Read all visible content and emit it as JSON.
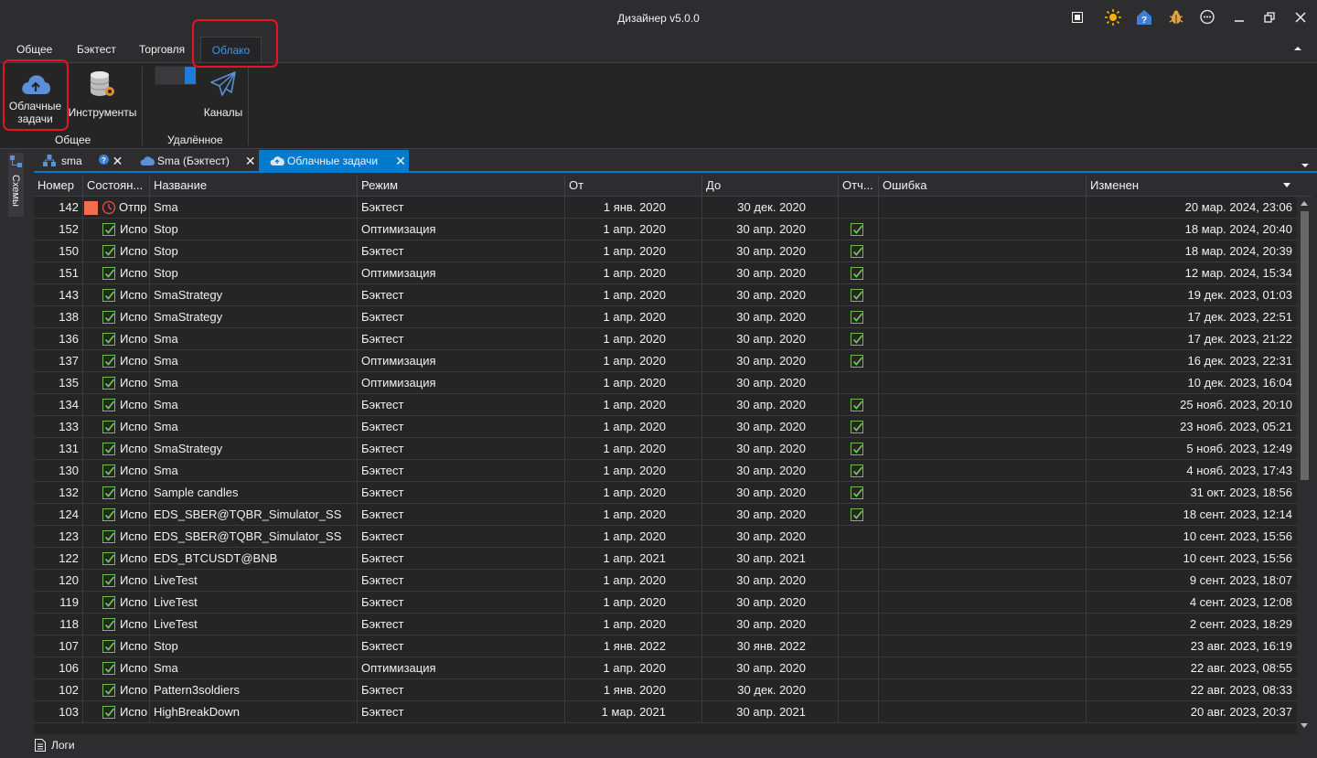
{
  "window": {
    "title": "Дизайнер v5.0.0"
  },
  "ribbon": {
    "tabs": [
      "Общее",
      "Бэктест",
      "Торговля",
      "Облако"
    ],
    "active_tab": "Облако",
    "buttons": {
      "cloud_tasks": "Облачные задачи",
      "cloud_tasks_line1": "Облачные",
      "cloud_tasks_line2": "задачи",
      "instruments": "Инструменты",
      "channels": "Каналы"
    },
    "groups": {
      "general": "Общее",
      "remote": "Удалённое"
    }
  },
  "side": {
    "schemes": "Схемы"
  },
  "doc_tabs": [
    {
      "label": "sma"
    },
    {
      "label": "Sma (Бэктест)"
    },
    {
      "label": "Облачные задачи"
    }
  ],
  "grid": {
    "columns": [
      "Номер",
      "Состоян...",
      "Название",
      "Режим",
      "От",
      "До",
      "Отч...",
      "Ошибка",
      "Изменен"
    ],
    "rows": [
      {
        "num": "142",
        "state": "Отпр",
        "name": "Sma",
        "mode": "Бэктест",
        "from": "1 янв. 2020",
        "to": "30 дек. 2020",
        "report": false,
        "error": "",
        "changed": "20 мар. 2024, 23:06",
        "pending": true
      },
      {
        "num": "152",
        "state": "Испо",
        "name": "Stop",
        "mode": "Оптимизация",
        "from": "1 апр. 2020",
        "to": "30 апр. 2020",
        "report": true,
        "error": "",
        "changed": "18 мар. 2024, 20:40"
      },
      {
        "num": "150",
        "state": "Испо",
        "name": "Stop",
        "mode": "Бэктест",
        "from": "1 апр. 2020",
        "to": "30 апр. 2020",
        "report": true,
        "error": "",
        "changed": "18 мар. 2024, 20:39"
      },
      {
        "num": "151",
        "state": "Испо",
        "name": "Stop",
        "mode": "Оптимизация",
        "from": "1 апр. 2020",
        "to": "30 апр. 2020",
        "report": true,
        "error": "",
        "changed": "12 мар. 2024, 15:34"
      },
      {
        "num": "143",
        "state": "Испо",
        "name": "SmaStrategy",
        "mode": "Бэктест",
        "from": "1 апр. 2020",
        "to": "30 апр. 2020",
        "report": true,
        "error": "",
        "changed": "19 дек. 2023, 01:03"
      },
      {
        "num": "138",
        "state": "Испо",
        "name": "SmaStrategy",
        "mode": "Бэктест",
        "from": "1 апр. 2020",
        "to": "30 апр. 2020",
        "report": true,
        "error": "",
        "changed": "17 дек. 2023, 22:51"
      },
      {
        "num": "136",
        "state": "Испо",
        "name": "Sma",
        "mode": "Бэктест",
        "from": "1 апр. 2020",
        "to": "30 апр. 2020",
        "report": true,
        "error": "",
        "changed": "17 дек. 2023, 21:22"
      },
      {
        "num": "137",
        "state": "Испо",
        "name": "Sma",
        "mode": "Оптимизация",
        "from": "1 апр. 2020",
        "to": "30 апр. 2020",
        "report": true,
        "error": "",
        "changed": "16 дек. 2023, 22:31"
      },
      {
        "num": "135",
        "state": "Испо",
        "name": "Sma",
        "mode": "Оптимизация",
        "from": "1 апр. 2020",
        "to": "30 апр. 2020",
        "report": false,
        "error": "",
        "changed": "10 дек. 2023, 16:04"
      },
      {
        "num": "134",
        "state": "Испо",
        "name": "Sma",
        "mode": "Бэктест",
        "from": "1 апр. 2020",
        "to": "30 апр. 2020",
        "report": true,
        "error": "",
        "changed": "25 нояб. 2023, 20:10"
      },
      {
        "num": "133",
        "state": "Испо",
        "name": "Sma",
        "mode": "Бэктест",
        "from": "1 апр. 2020",
        "to": "30 апр. 2020",
        "report": true,
        "error": "",
        "changed": "23 нояб. 2023, 05:21"
      },
      {
        "num": "131",
        "state": "Испо",
        "name": "SmaStrategy",
        "mode": "Бэктест",
        "from": "1 апр. 2020",
        "to": "30 апр. 2020",
        "report": true,
        "error": "",
        "changed": "5 нояб. 2023, 12:49"
      },
      {
        "num": "130",
        "state": "Испо",
        "name": "Sma",
        "mode": "Бэктест",
        "from": "1 апр. 2020",
        "to": "30 апр. 2020",
        "report": true,
        "error": "",
        "changed": "4 нояб. 2023, 17:43"
      },
      {
        "num": "132",
        "state": "Испо",
        "name": "Sample candles",
        "mode": "Бэктест",
        "from": "1 апр. 2020",
        "to": "30 апр. 2020",
        "report": true,
        "error": "",
        "changed": "31 окт. 2023, 18:56"
      },
      {
        "num": "124",
        "state": "Испо",
        "name": "EDS_SBER@TQBR_Simulator_SS",
        "mode": "Бэктест",
        "from": "1 апр. 2020",
        "to": "30 апр. 2020",
        "report": true,
        "error": "",
        "changed": "18 сент. 2023, 12:14"
      },
      {
        "num": "123",
        "state": "Испо",
        "name": "EDS_SBER@TQBR_Simulator_SS",
        "mode": "Бэктест",
        "from": "1 апр. 2020",
        "to": "30 апр. 2020",
        "report": false,
        "error": "",
        "changed": "10 сент. 2023, 15:56"
      },
      {
        "num": "122",
        "state": "Испо",
        "name": "EDS_BTCUSDT@BNB",
        "mode": "Бэктест",
        "from": "1 апр. 2021",
        "to": "30 апр. 2021",
        "report": false,
        "error": "",
        "changed": "10 сент. 2023, 15:56"
      },
      {
        "num": "120",
        "state": "Испо",
        "name": "LiveTest",
        "mode": "Бэктест",
        "from": "1 апр. 2020",
        "to": "30 апр. 2020",
        "report": false,
        "error": "",
        "changed": "9 сент. 2023, 18:07"
      },
      {
        "num": "119",
        "state": "Испо",
        "name": "LiveTest",
        "mode": "Бэктест",
        "from": "1 апр. 2020",
        "to": "30 апр. 2020",
        "report": false,
        "error": "",
        "changed": "4 сент. 2023, 12:08"
      },
      {
        "num": "118",
        "state": "Испо",
        "name": "LiveTest",
        "mode": "Бэктест",
        "from": "1 апр. 2020",
        "to": "30 апр. 2020",
        "report": false,
        "error": "",
        "changed": "2 сент. 2023, 18:29"
      },
      {
        "num": "107",
        "state": "Испо",
        "name": "Stop",
        "mode": "Бэктест",
        "from": "1 янв. 2022",
        "to": "30 янв. 2022",
        "report": false,
        "error": "",
        "changed": "23 авг. 2023, 16:19"
      },
      {
        "num": "106",
        "state": "Испо",
        "name": "Sma",
        "mode": "Оптимизация",
        "from": "1 апр. 2020",
        "to": "30 апр. 2020",
        "report": false,
        "error": "",
        "changed": "22 авг. 2023, 08:55"
      },
      {
        "num": "102",
        "state": "Испо",
        "name": "Pattern3soldiers",
        "mode": "Бэктест",
        "from": "1 янв. 2020",
        "to": "30 дек. 2020",
        "report": false,
        "error": "",
        "changed": "22 авг. 2023, 08:33"
      },
      {
        "num": "103",
        "state": "Испо",
        "name": "HighBreakDown",
        "mode": "Бэктест",
        "from": "1 мар. 2021",
        "to": "30 апр. 2021",
        "report": false,
        "error": "",
        "changed": "20 авг. 2023, 20:37"
      }
    ]
  },
  "bottom": {
    "logs": "Логи"
  },
  "colors": {
    "accent": "#007acc",
    "highlight": "#e81123",
    "check": "#6cc24a",
    "pending": "#f26c4f"
  }
}
